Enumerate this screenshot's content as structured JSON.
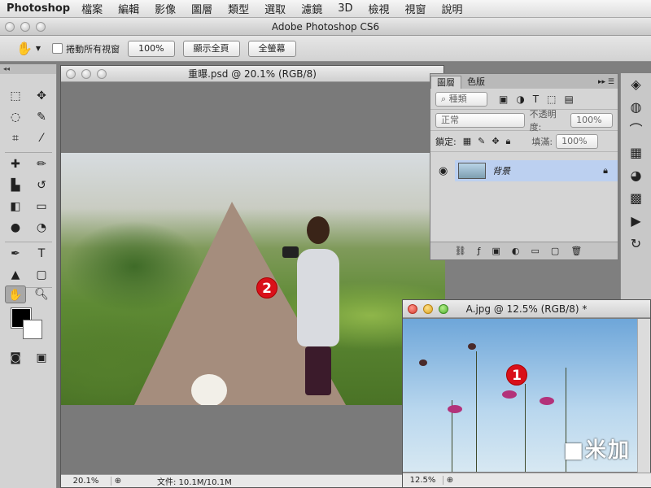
{
  "menubar": {
    "app": "Photoshop",
    "items": [
      "檔案",
      "編輯",
      "影像",
      "圖層",
      "類型",
      "選取",
      "濾鏡",
      "3D",
      "檢視",
      "視窗",
      "說明"
    ]
  },
  "app_title": "Adobe Photoshop CS6",
  "options": {
    "scroll_all": "捲動所有視窗",
    "zoom_100": "100%",
    "fit_screen": "顯示全頁",
    "full_screen": "全螢幕"
  },
  "doc1": {
    "title": "重曝.psd @ 20.1% (RGB/8)",
    "zoom": "20.1%",
    "status": "文件: 10.1M/10.1M",
    "badge": "2"
  },
  "layers_panel": {
    "tab_layers": "圖層",
    "tab_channels": "色版",
    "filter_kind": "種類",
    "blend_mode": "正常",
    "opacity_label": "不透明度:",
    "opacity_value": "100%",
    "lock_label": "鎖定:",
    "fill_label": "填滿:",
    "fill_value": "100%",
    "layer_name": "背景"
  },
  "doc2": {
    "title": "A.jpg @ 12.5% (RGB/8) *",
    "zoom": "12.5%",
    "badge": "1"
  }
}
